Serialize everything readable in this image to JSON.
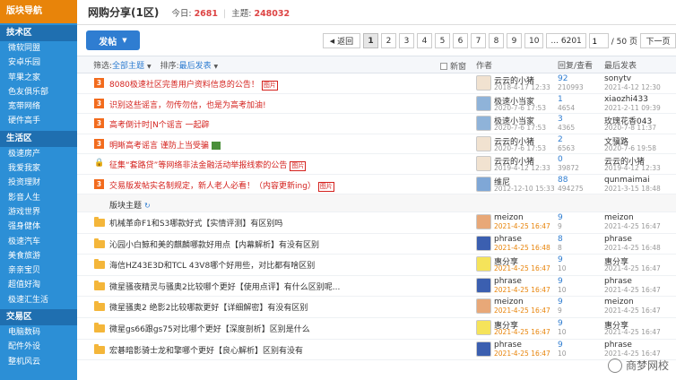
{
  "sidebar": {
    "top": "版块导航",
    "sections": [
      {
        "title": "技术区",
        "items": [
          "微软同盟",
          "安卓乐园",
          "苹果之家",
          "色友俱乐部",
          "宽带网络",
          "硬件高手"
        ]
      },
      {
        "title": "生活区",
        "items": [
          "极速房产",
          "我爱我家",
          "投资理财",
          "影音人生",
          "游戏世界",
          "强身健体",
          "极速汽车",
          "美食旅游",
          "亲亲宝贝",
          "超值好淘",
          "极速汇生活"
        ]
      },
      {
        "title": "交易区",
        "items": [
          "电脑数码",
          "配件外设",
          "整机风云"
        ]
      }
    ]
  },
  "header": {
    "title": "网购分享(1区)",
    "today_label": "今日:",
    "today_value": "2681",
    "topic_label": "主题:",
    "topic_value": "248032"
  },
  "toolbar": {
    "post_label": "发帖",
    "pager": {
      "back": "返回",
      "pages": [
        "1",
        "2",
        "3",
        "4",
        "5",
        "6",
        "7",
        "8",
        "9",
        "10",
        "... 6201"
      ],
      "current": "1",
      "input_value": "1",
      "total": "/ 50 页",
      "next": "下一页"
    }
  },
  "table_head": {
    "filter_label": "筛选:",
    "filter_value": "全部主题",
    "sort_label": "排序:",
    "sort_value": "最后发表",
    "new_label": "新窗",
    "col_author": "作者",
    "col_reply": "回复/查看",
    "col_last": "最后发表"
  },
  "sticky_threads": [
    {
      "icon": "top",
      "title": "8080极速社区完善用户资料信息的公告！",
      "tag": "图片",
      "author": "云云的小猪",
      "date": "2018-4-17 12:33",
      "replies": "92",
      "views": "210993",
      "last_user": "sonytv",
      "last_date": "2021-4-12 12:30",
      "avatar_color": "#f1e2d0"
    },
    {
      "icon": "top",
      "title": "识别这些谣言，勿传勿信，也是为高考加油!",
      "tag": "",
      "author": "极速小当家",
      "date": "2020-7-6 17:53",
      "replies": "1",
      "views": "4654",
      "last_user": "xiaozhi433",
      "last_date": "2021-2-11 09:39",
      "avatar_color": "#8fb3d9"
    },
    {
      "icon": "top",
      "title": "高考倒计时|N个谣言 一起辟",
      "tag": "",
      "author": "极速小当家",
      "date": "2020-7-6 17:53",
      "replies": "3",
      "views": "4365",
      "last_user": "玫瑰花香043",
      "last_date": "2020-7-8 11:37",
      "avatar_color": "#8fb3d9"
    },
    {
      "icon": "top",
      "title": "明晰高考谣言 谨防上当受骗",
      "tag": "img",
      "author": "云云的小猪",
      "date": "2020-7-6 17:53",
      "replies": "2",
      "views": "6563",
      "last_user": "文骥路",
      "last_date": "2020-7-6 19:58",
      "avatar_color": "#f1e2d0"
    },
    {
      "icon": "lock",
      "title": "征集“套路贷”等网络非法金融活动举报线索的公告",
      "tag": "图片",
      "author": "云云的小猪",
      "date": "2019-4-12 12:33",
      "replies": "0",
      "views": "39872",
      "last_user": "云云的小猪",
      "last_date": "2019-4-12 12:33",
      "avatar_color": "#f1e2d0"
    },
    {
      "icon": "top",
      "title": "交易版发帖实名制规定，新人老人必看！（内容更新ing）",
      "tag": "图片",
      "author": "维尼",
      "date": "2012-12-10 15:33",
      "replies": "88",
      "views": "494275",
      "last_user": "qunmaimai",
      "last_date": "2021-3-15 18:48",
      "avatar_color": "#7fa7d6"
    }
  ],
  "section_label": "版块主题",
  "normal_threads": [
    {
      "title": "机械革命F1和S3哪款好式【实情评测】有区别吗",
      "author": "meizon",
      "date": "2021-4-25 16:47",
      "replies": "9",
      "views": "9",
      "last_user": "meizon",
      "last_date": "2021-4-25 16:47",
      "avatar_color": "#e8a878"
    },
    {
      "title": "沁园小白鲸和美的麒麟哪款好用点【内幕解析】有没有区别",
      "author": "phrase",
      "date": "2021-4-25 16:48",
      "replies": "8",
      "views": "8",
      "last_user": "phrase",
      "last_date": "2021-4-25 16:48",
      "avatar_color": "#3b5fb0"
    },
    {
      "title": "海信HZ43E3D和TCL 43V8哪个好用些，对比都有啥区别",
      "author": "惠分享",
      "date": "2021-4-25 16:47",
      "replies": "9",
      "views": "10",
      "last_user": "惠分享",
      "last_date": "2021-4-25 16:47",
      "avatar_color": "#f5e35a"
    },
    {
      "title": "微星骚夜精灵与骚奥2比较哪个更好【使用点评】有什么区别呢...",
      "author": "phrase",
      "date": "2021-4-25 16:47",
      "replies": "9",
      "views": "10",
      "last_user": "phrase",
      "last_date": "2021-4-25 16:47",
      "avatar_color": "#3b5fb0"
    },
    {
      "title": "微星骚奥2 绝影2比较哪款更好【详细解密】有没有区别",
      "author": "meizon",
      "date": "2021-4-25 16:47",
      "replies": "9",
      "views": "9",
      "last_user": "meizon",
      "last_date": "2021-4-25 16:47",
      "avatar_color": "#e8a878"
    },
    {
      "title": "微星gs66跟gs75对比哪个更好【深度剖析】区别是什么",
      "author": "惠分享",
      "date": "2021-4-25 16:47",
      "replies": "9",
      "views": "10",
      "last_user": "惠分享",
      "last_date": "2021-4-25 16:47",
      "avatar_color": "#f5e35a"
    },
    {
      "title": "宏碁暗影骑士龙和擎哪个更好【良心解析】区别有没有",
      "author": "phrase",
      "date": "2021-4-25 16:47",
      "replies": "9",
      "views": "10",
      "last_user": "phrase",
      "last_date": "2021-4-25 16:47",
      "avatar_color": "#3b5fb0"
    }
  ],
  "watermark": "商梦网校"
}
